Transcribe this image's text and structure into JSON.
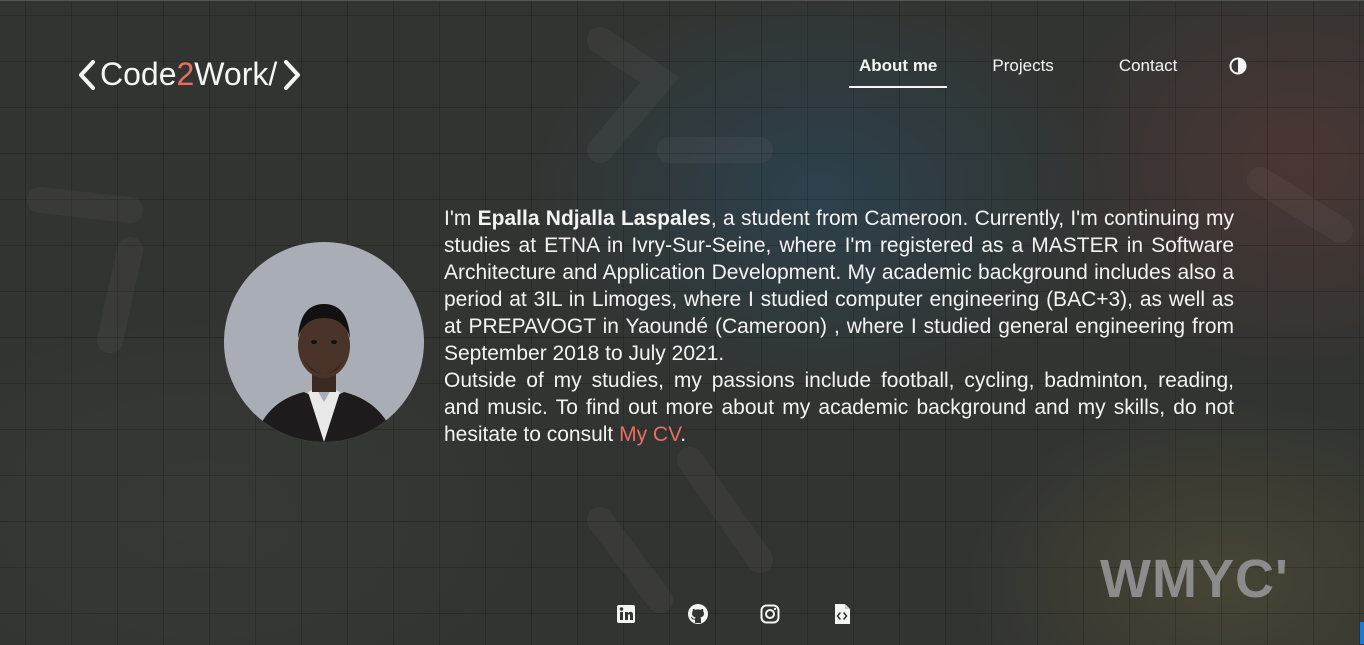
{
  "logo": {
    "text_before": "Code",
    "text_accent": "2",
    "text_after": "Work/",
    "accent_color": "#e86d63",
    "left_icon": "chevron-left-icon",
    "right_icon": "chevron-right-icon"
  },
  "nav": {
    "items": [
      {
        "label": "About me",
        "active": true
      },
      {
        "label": "Projects",
        "active": false
      },
      {
        "label": "Contact",
        "active": false
      }
    ],
    "theme_toggle_icon": "contrast-icon"
  },
  "bio": {
    "p1_a": "I'm ",
    "name": "Epalla Ndjalla Laspales",
    "p1_b": ", a student from Cameroon. Currently, I'm continuing my studies at ETNA in Ivry-Sur-Seine, where I'm registered as a MASTER in Software Architecture and Application Development. My academic background includes also a period at 3IL in Limoges, where I studied computer engineering (BAC+3), as well as at PREPAVOGT in Yaoundé (Cameroon) , where I studied general engineering from September 2018 to July 2021.",
    "p2_a": "Outside of my studies, my passions include football, cycling, badminton, reading, and music. To find out more about my academic background and my skills, do not hesitate to consult ",
    "cv_link": "My CV",
    "p2_b": "."
  },
  "watermark": "WMYC'",
  "socials": [
    {
      "icon": "linkedin-icon"
    },
    {
      "icon": "github-icon"
    },
    {
      "icon": "instagram-icon"
    },
    {
      "icon": "cv-file-icon"
    }
  ],
  "colors": {
    "background": "#333531",
    "text": "#f2f2f2",
    "accent": "#e86d63",
    "avatar_bg": "#a9aeb6"
  }
}
